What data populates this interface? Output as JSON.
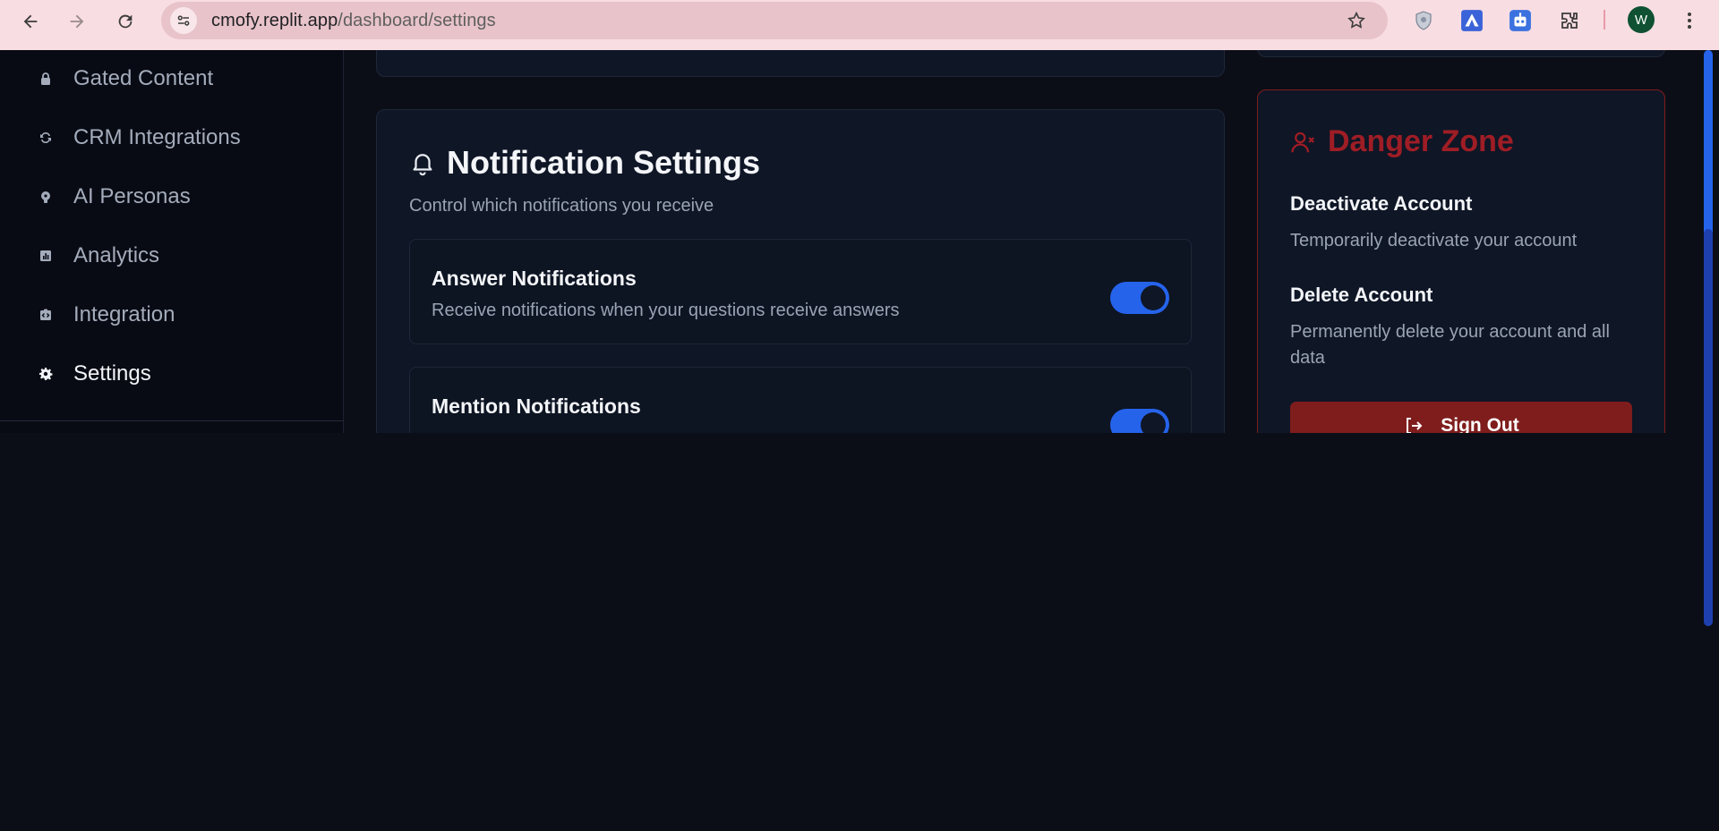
{
  "browser": {
    "url_host": "cmofy.replit.app",
    "url_path": "/dashboard/settings",
    "avatar_initial": "W"
  },
  "sidebar": {
    "items": [
      {
        "label": "Gated Content",
        "icon": "lock-icon"
      },
      {
        "label": "CRM Integrations",
        "icon": "sync-icon"
      },
      {
        "label": "AI Personas",
        "icon": "brain-icon"
      },
      {
        "label": "Analytics",
        "icon": "bar-chart-icon"
      },
      {
        "label": "Integration",
        "icon": "code-icon"
      },
      {
        "label": "Settings",
        "icon": "gear-icon",
        "active": true
      }
    ]
  },
  "notifications": {
    "title": "Notification Settings",
    "description": "Control which notifications you receive",
    "rows": [
      {
        "title": "Answer Notifications",
        "description": "Receive notifications when your questions receive answers",
        "enabled": true
      },
      {
        "title": "Mention Notifications",
        "description": "",
        "enabled": true
      }
    ]
  },
  "danger": {
    "title": "Danger Zone",
    "deactivate_title": "Deactivate Account",
    "deactivate_desc": "Temporarily deactivate your account",
    "delete_title": "Delete Account",
    "delete_desc": "Permanently delete your account and all data",
    "signout_label": "Sign Out"
  },
  "colors": {
    "accent": "#2563eb",
    "danger": "#9f1d25",
    "background": "#0b0e17"
  }
}
